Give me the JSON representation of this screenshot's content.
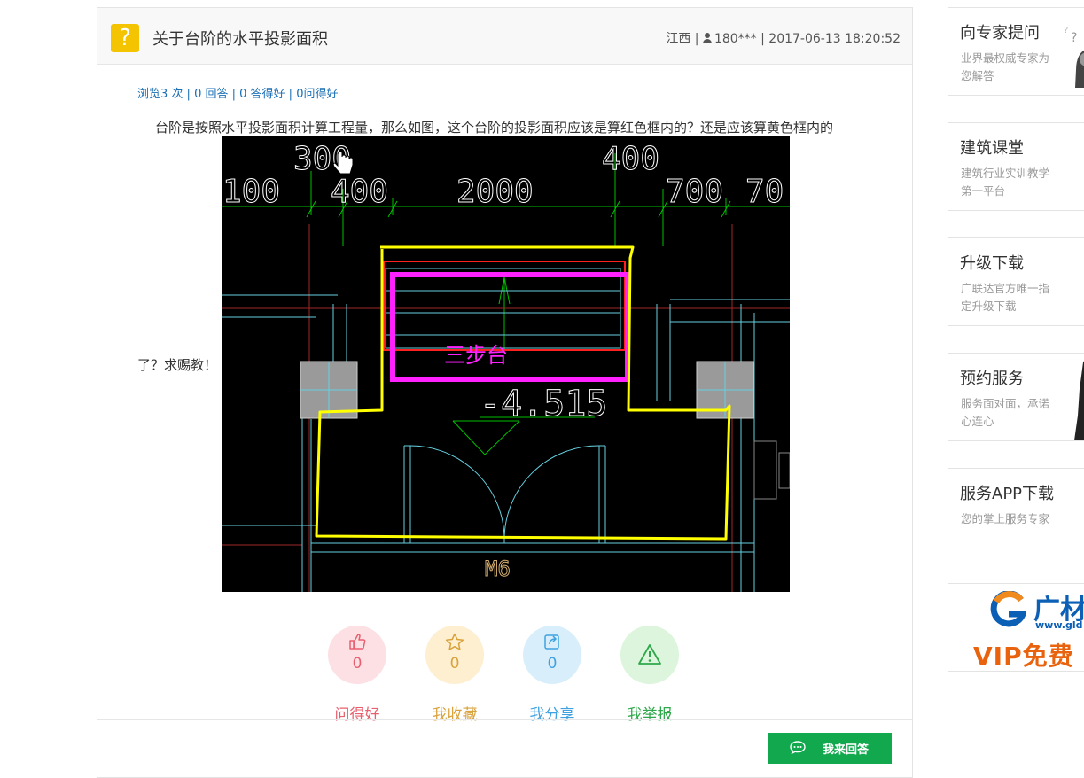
{
  "question": {
    "title": "关于台阶的水平投影面积",
    "meta": {
      "region": "江西 |",
      "user": "180***",
      "datetime": "| 2017-06-13 18:20:52"
    },
    "stats": {
      "views": "浏览3 次",
      "answers": "0 回答",
      "good_answers": "0 答得好",
      "good_questions": "0问得好",
      "separator": " | "
    },
    "body_line1": "台阶是按照水平投影面积计算工程量，那么如图，这个台阶的投影面积应该是算红色框内的？还是应该算黄色框内的",
    "body_line2": "了？求赐教！",
    "drawing": {
      "dims_top": [
        "300",
        "400"
      ],
      "dims_row2": [
        "100",
        "400",
        "2000",
        "700",
        "70"
      ],
      "label_steps": "三步台",
      "elevation": "-4.515",
      "door_label": "M6",
      "colors": {
        "background": "#000000",
        "yellow_frame": "#ffff00",
        "red_frame": "#ff2020",
        "magenta_frame": "#ff22ff",
        "dim_lines": "#00c000",
        "walls": "#66d0e0",
        "axis": "#c03030"
      }
    }
  },
  "actions": [
    {
      "icon": "thumbs-up-icon",
      "count": "0",
      "label": "问得好"
    },
    {
      "icon": "star-icon",
      "count": "0",
      "label": "我收藏"
    },
    {
      "icon": "share-icon",
      "count": "0",
      "label": "我分享"
    },
    {
      "icon": "warning-icon",
      "count": "",
      "label": "我举报"
    }
  ],
  "answer_button": "我来回答",
  "sidebar": [
    {
      "title": "向专家提问",
      "desc": "业界最权威专家为您解答"
    },
    {
      "title": "建筑课堂",
      "desc": "建筑行业实训教学第一平台"
    },
    {
      "title": "升级下载",
      "desc": "广联达官方唯一指定升级下载"
    },
    {
      "title": "预约服务",
      "desc": "服务面对面，承诺心连心"
    },
    {
      "title": "服务APP下载",
      "desc": "您的掌上服务专家"
    }
  ],
  "ad": {
    "brand": "广材",
    "url": "www.gld",
    "slogan": "VIP免费"
  }
}
